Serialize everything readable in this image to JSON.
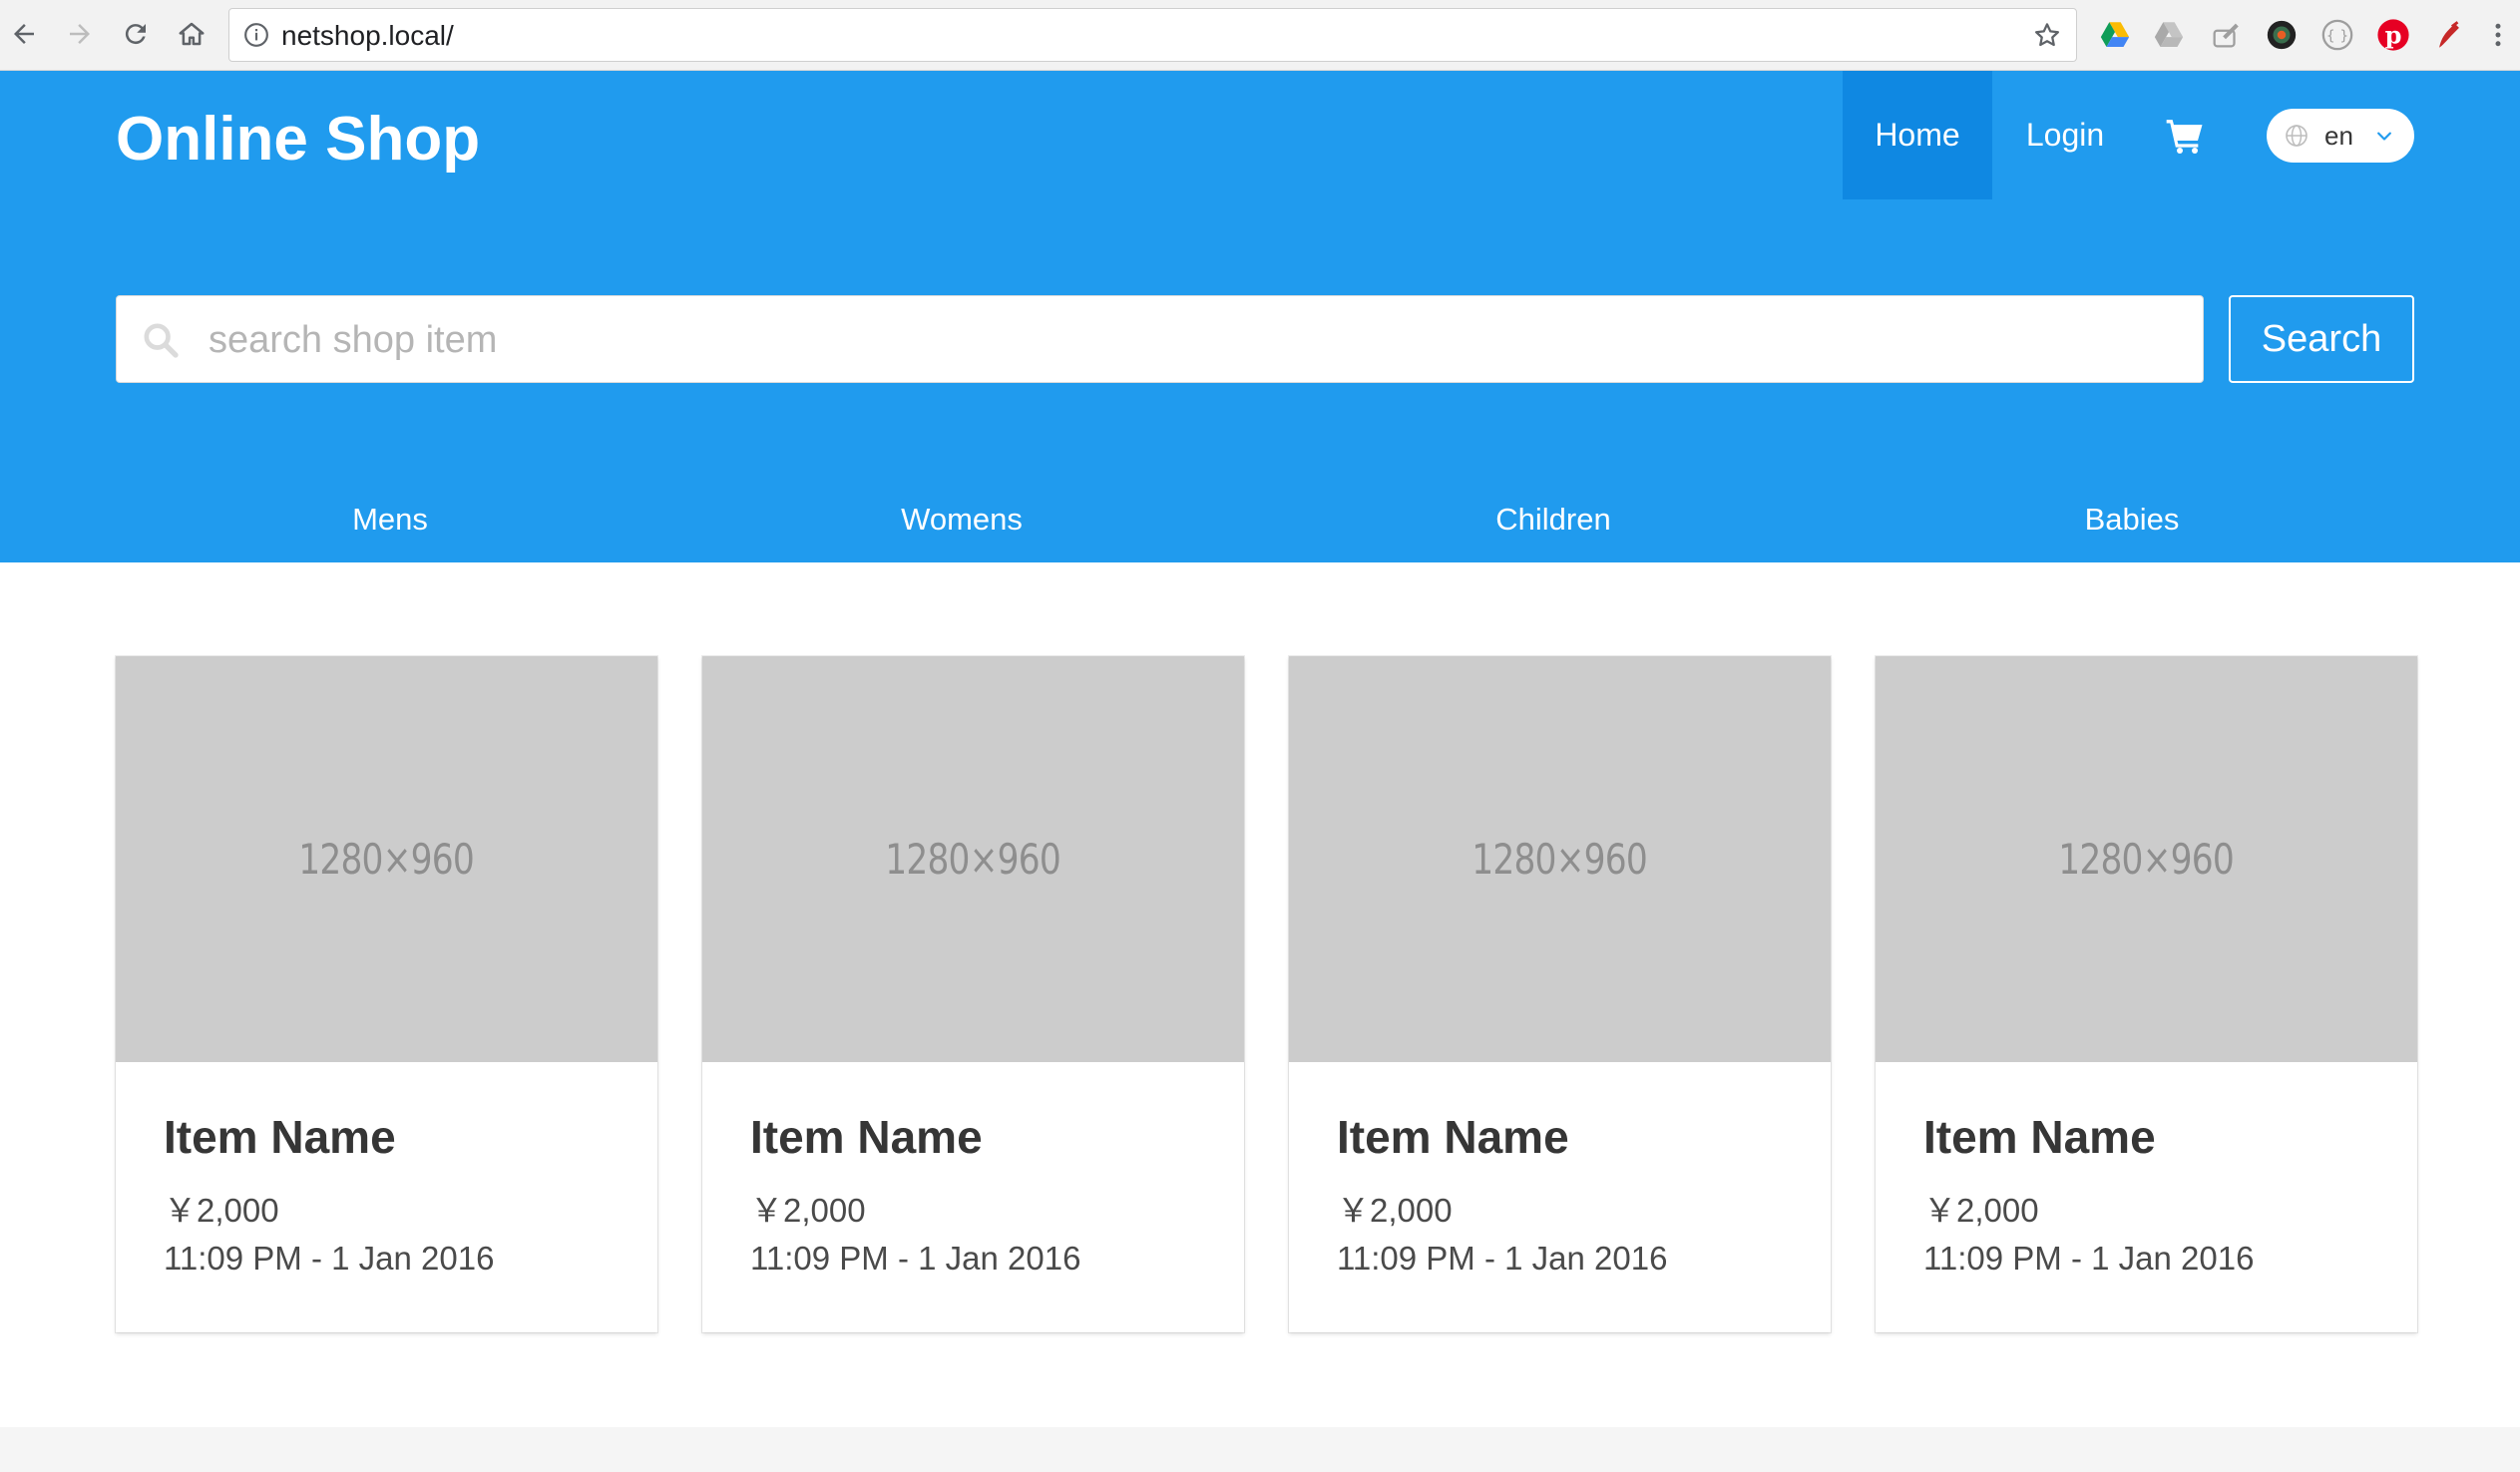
{
  "browser": {
    "url": "netshop.local/",
    "extension_icons": [
      "google-drive-icon",
      "drive-grey-icon",
      "brush-icon",
      "camera-lens-icon",
      "circle-dotted-icon",
      "pinterest-icon",
      "red-pen-icon"
    ]
  },
  "header": {
    "brand": "Online Shop",
    "nav": {
      "home": "Home",
      "login": "Login"
    },
    "language": "en",
    "colors": {
      "header_bg": "#209bee",
      "active_nav_bg": "#0f88e2"
    }
  },
  "search": {
    "placeholder": "search shop item",
    "value": "",
    "button": "Search"
  },
  "categories": [
    "Mens",
    "Womens",
    "Children",
    "Babies"
  ],
  "items": [
    {
      "image_label": "1280×960",
      "name": "Item Name",
      "price": "￥2,000",
      "date": "11:09 PM - 1 Jan 2016"
    },
    {
      "image_label": "1280×960",
      "name": "Item Name",
      "price": "￥2,000",
      "date": "11:09 PM - 1 Jan 2016"
    },
    {
      "image_label": "1280×960",
      "name": "Item Name",
      "price": "￥2,000",
      "date": "11:09 PM - 1 Jan 2016"
    },
    {
      "image_label": "1280×960",
      "name": "Item Name",
      "price": "￥2,000",
      "date": "11:09 PM - 1 Jan 2016"
    }
  ]
}
